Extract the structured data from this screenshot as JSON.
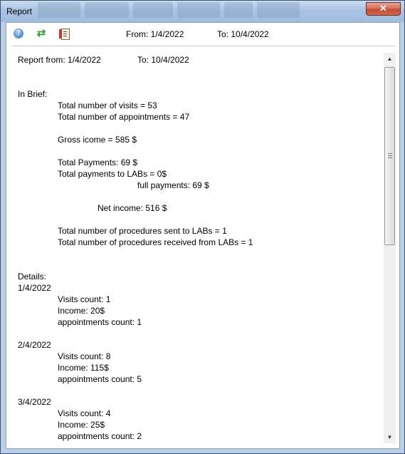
{
  "window": {
    "title": "Report",
    "close_glyph": "✕"
  },
  "toolbar": {
    "help_icon": "help-icon",
    "refresh_icon": "refresh-icon",
    "report_icon": "report-icon",
    "from_text": "From: 1/4/2022",
    "to_text": "To: 10/4/2022"
  },
  "report": {
    "header_from": "Report from: 1/4/2022",
    "header_to": "To: 10/4/2022",
    "brief_heading": "In Brief:",
    "total_visits": "Total number of visits = 53",
    "total_appointments": "Total number of appointments = 47",
    "gross_income": "Gross icome = 585 $",
    "total_payments": "Total Payments: 69 $",
    "payments_to_labs": "Total payments to LABs = 0$",
    "full_payments": "full payments: 69 $",
    "net_income": "Net income: 516 $",
    "procedures_sent": "Total number of procedures sent to LABs = 1",
    "procedures_received": "Total number of procedures received from LABs = 1",
    "details_heading": "Details:",
    "days": [
      {
        "date": "1/4/2022",
        "visits": "Visits count: 1",
        "income": "Income: 20$",
        "appointments": "appointments count: 1"
      },
      {
        "date": "2/4/2022",
        "visits": "Visits count: 8",
        "income": "Income: 115$",
        "appointments": "appointments count: 5"
      },
      {
        "date": "3/4/2022",
        "visits": "Visits count: 4",
        "income": "Income: 25$",
        "appointments": "appointments count: 2"
      }
    ]
  },
  "scrollbar": {
    "up_glyph": "▲",
    "down_glyph": "▼"
  }
}
